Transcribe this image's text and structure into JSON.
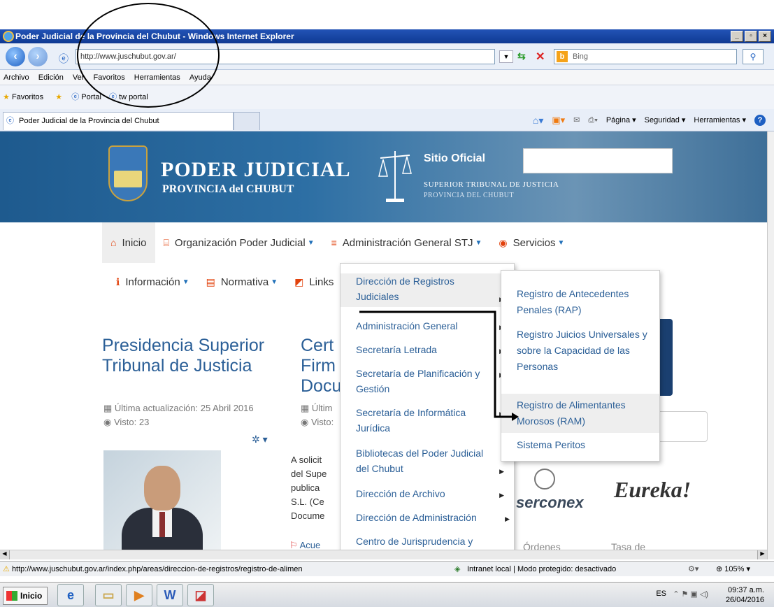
{
  "window": {
    "title": "Poder Judicial de la Provincia del Chubut - Windows Internet Explorer"
  },
  "browser": {
    "url": "http://www.juschubut.gov.ar/",
    "search_placeholder": "Bing",
    "menu": [
      "Archivo",
      "Edición",
      "Ver",
      "Favoritos",
      "Herramientas",
      "Ayuda"
    ],
    "favorites_label": "Favoritos",
    "favorites_items": [
      "Portal",
      "tw portal"
    ],
    "tab_title": "Poder Judicial de la Provincia del Chubut",
    "command_bar": [
      "Página",
      "Seguridad",
      "Herramientas"
    ]
  },
  "banner": {
    "title": "PODER JUDICIAL",
    "subtitle": "PROVINCIA del CHUBUT",
    "sitio": "Sitio Oficial",
    "stj": "SUPERIOR TRIBUNAL DE JUSTICIA",
    "stj_sub": "PROVINCIA DEL CHUBUT"
  },
  "nav": {
    "row1": [
      "Inicio",
      "Organización Poder Judicial",
      "Administración General STJ",
      "Servicios"
    ],
    "row2": [
      "Información",
      "Normativa",
      "Links"
    ]
  },
  "dropdown1": [
    {
      "label": "Dirección de Registros Judiciales",
      "arrow": true
    },
    {
      "label": "Administración General",
      "arrow": true
    },
    {
      "label": "Secretaría Letrada",
      "arrow": true
    },
    {
      "label": "Secretaría de Planificación y Gestión",
      "arrow": true
    },
    {
      "label": "Secretaría de Informática Jurídica",
      "arrow": true
    },
    {
      "label": "Bibliotecas del Poder Judicial del Chubut",
      "arrow": true
    },
    {
      "label": "Dirección de Archivo",
      "arrow": true
    },
    {
      "label": "Dirección de Administración",
      "arrow": true
    },
    {
      "label": "Centro de Jurisprudencia y",
      "arrow": false
    }
  ],
  "dropdown2": [
    "Registro de Antecedentes Penales (RAP)",
    "Registro Juicios Universales y sobre la Capacidad de las Personas",
    "Registro de Alimentantes Morosos (RAM)",
    "Sistema Peritos"
  ],
  "article1": {
    "title": "Presidencia Superior Tribunal de Justicia",
    "updated": "Última actualización: 25 Abril 2016",
    "views": "Visto: 23"
  },
  "article2": {
    "title": "Cert Firm Docu",
    "updated": "Últim",
    "views": "Visto:",
    "body": [
      "A solicit",
      "del Supe",
      "publica",
      "S.L. (Ce",
      "Docume"
    ],
    "link": "Acue"
  },
  "logos": {
    "serconex": "serconex",
    "eureka": "Eureka!",
    "ordenes": "Órdenes",
    "tasa": "Tasa de"
  },
  "status": {
    "url": "http://www.juschubut.gov.ar/index.php/areas/direccion-de-registros/registro-de-alimen",
    "zone": "Intranet local | Modo protegido: desactivado",
    "zoom": "105%"
  },
  "taskbar": {
    "start": "Inicio",
    "lang": "ES",
    "time": "09:37 a.m.",
    "date": "26/04/2016"
  }
}
